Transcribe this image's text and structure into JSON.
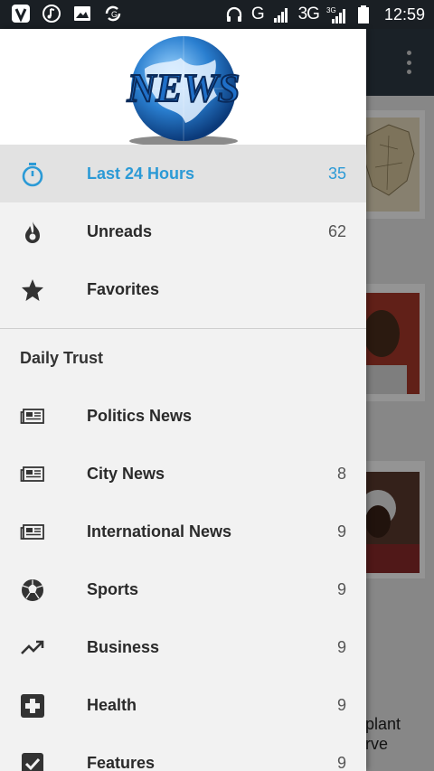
{
  "status_bar": {
    "network": "G",
    "network_3g": "3G",
    "network_3g_sup": "3G",
    "time": "12:59",
    "icons": [
      "vine-icon",
      "music-icon",
      "image-icon",
      "data-saver-icon",
      "headphones-icon",
      "signal-icon",
      "signal-3g-icon",
      "battery-icon"
    ]
  },
  "background": {
    "snippet_line1": "plant",
    "snippet_line2": "rve"
  },
  "header": {
    "logo_text": "NEWS"
  },
  "primary_items": [
    {
      "label": "Last 24 Hours",
      "count": "35",
      "icon": "stopwatch-icon",
      "active": true
    },
    {
      "label": "Unreads",
      "count": "62",
      "icon": "flame-icon"
    },
    {
      "label": "Favorites",
      "count": "",
      "icon": "star-icon"
    }
  ],
  "section": {
    "title": "Daily Trust"
  },
  "feed_items": [
    {
      "label": "Politics News",
      "count": "",
      "icon": "newspaper-icon"
    },
    {
      "label": "City News",
      "count": "8",
      "icon": "newspaper-icon"
    },
    {
      "label": "International News",
      "count": "9",
      "icon": "newspaper-icon"
    },
    {
      "label": "Sports",
      "count": "9",
      "icon": "soccer-ball-icon"
    },
    {
      "label": "Business",
      "count": "9",
      "icon": "trending-up-icon"
    },
    {
      "label": "Health",
      "count": "9",
      "icon": "medical-cross-icon"
    },
    {
      "label": "Features",
      "count": "9",
      "icon": "checkbox-icon"
    }
  ],
  "colors": {
    "accent": "#2b9ad6",
    "toolbar": "#2d3a44",
    "drawer_bg": "#f2f2f2"
  }
}
